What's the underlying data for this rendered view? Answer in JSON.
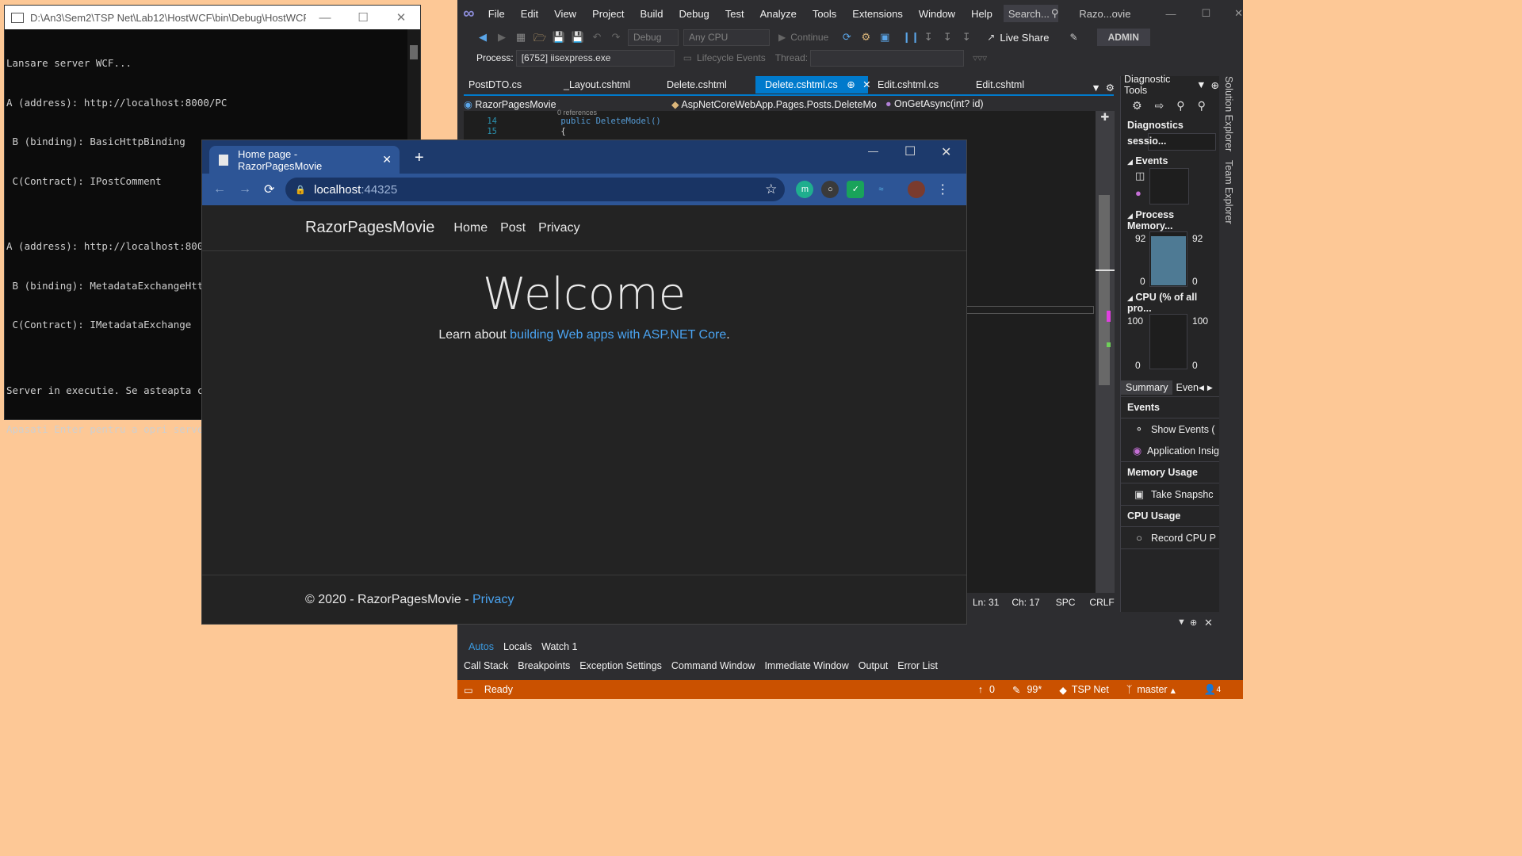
{
  "console": {
    "title": "D:\\An3\\Sem2\\TSP Net\\Lab12\\HostWCF\\bin\\Debug\\HostWCF.e...",
    "lines": [
      "Lansare server WCF...",
      "A (address): http://localhost:8000/PC",
      " B (binding): BasicHttpBinding",
      " C(Contract): IPostComment",
      "",
      "A (address): http://localhost:8000/PC/mex",
      " B (binding): MetadataExchangeHttpBinding",
      " C(Contract): IMetadataExchange",
      "",
      "Server in executie. Se asteapta co",
      "Apasati Enter pentru a opri server"
    ]
  },
  "vs": {
    "menu": [
      "File",
      "Edit",
      "View",
      "Project",
      "Build",
      "Debug",
      "Test",
      "Analyze",
      "Tools",
      "Extensions",
      "Window",
      "Help"
    ],
    "search_placeholder": "Search...",
    "solution_name": "Razo...ovie",
    "config": "Debug",
    "platform": "Any CPU",
    "continue_label": "Continue",
    "live_share": "Live Share",
    "user_badge": "ADMIN",
    "process_label": "Process:",
    "process_value": "[6752] iisexpress.exe",
    "lifecycle_label": "Lifecycle Events",
    "thread_label": "Thread:",
    "tabs": [
      {
        "label": "PostDTO.cs",
        "active": false
      },
      {
        "label": "_Layout.cshtml",
        "active": false
      },
      {
        "label": "Delete.cshtml",
        "active": false
      },
      {
        "label": "Delete.cshtml.cs",
        "active": true
      },
      {
        "label": "Edit.cshtml.cs",
        "active": false
      },
      {
        "label": "Edit.cshtml",
        "active": false
      }
    ],
    "nav_project": "RazorPagesMovie",
    "nav_class": "AspNetCoreWebApp.Pages.Posts.DeleteMo",
    "nav_member": "OnGetAsync(int? id)",
    "code_refs": "0 references",
    "code_lines": [
      {
        "num": "14",
        "text": "public DeleteModel()"
      },
      {
        "num": "15",
        "text": "{"
      }
    ],
    "editor_status": {
      "ln": "Ln: 31",
      "ch": "Ch: 17",
      "spc": "SPC",
      "crlf": "CRLF"
    },
    "bottom_panel_title": "Autos",
    "bottom_tabs": [
      "Autos",
      "Locals",
      "Watch 1"
    ],
    "tool_tabs": [
      "Call Stack",
      "Breakpoints",
      "Exception Settings",
      "Command Window",
      "Immediate Window",
      "Output",
      "Error List"
    ],
    "status": {
      "ready": "Ready",
      "up": "0",
      "edits": "99*",
      "repo": "TSP Net",
      "branch": "master",
      "notif": "4"
    },
    "side_tabs": [
      "Solution Explorer",
      "Team Explorer"
    ],
    "diag": {
      "title": "Diagnostic Tools",
      "session": "Diagnostics sessio...",
      "events": "Events",
      "memory": "Process Memory...",
      "mem_max_l": "92",
      "mem_max_r": "92",
      "mem_min_l": "0",
      "mem_min_r": "0",
      "cpu": "CPU (% of all pro...",
      "cpu_max_l": "100",
      "cpu_max_r": "100",
      "cpu_min_l": "0",
      "cpu_min_r": "0",
      "tab_summary": "Summary",
      "tab_events": "Even",
      "sec_events": "Events",
      "show_events": "Show Events (",
      "app_insights": "Application Insig",
      "sec_memory": "Memory Usage",
      "take_snapshot": "Take Snapshc",
      "sec_cpu": "CPU Usage",
      "record_cpu": "Record CPU P"
    }
  },
  "browser": {
    "tab_title": "Home page - RazorPagesMovie",
    "url_host": "localhost",
    "url_port": ":44325",
    "brand": "RazorPagesMovie",
    "nav": [
      "Home",
      "Post",
      "Privacy"
    ],
    "heading": "Welcome",
    "learn_prefix": "Learn about ",
    "learn_link": "building Web apps with ASP.NET Core",
    "learn_suffix": ".",
    "footer_text": "© 2020 - RazorPagesMovie - ",
    "footer_link": "Privacy"
  }
}
